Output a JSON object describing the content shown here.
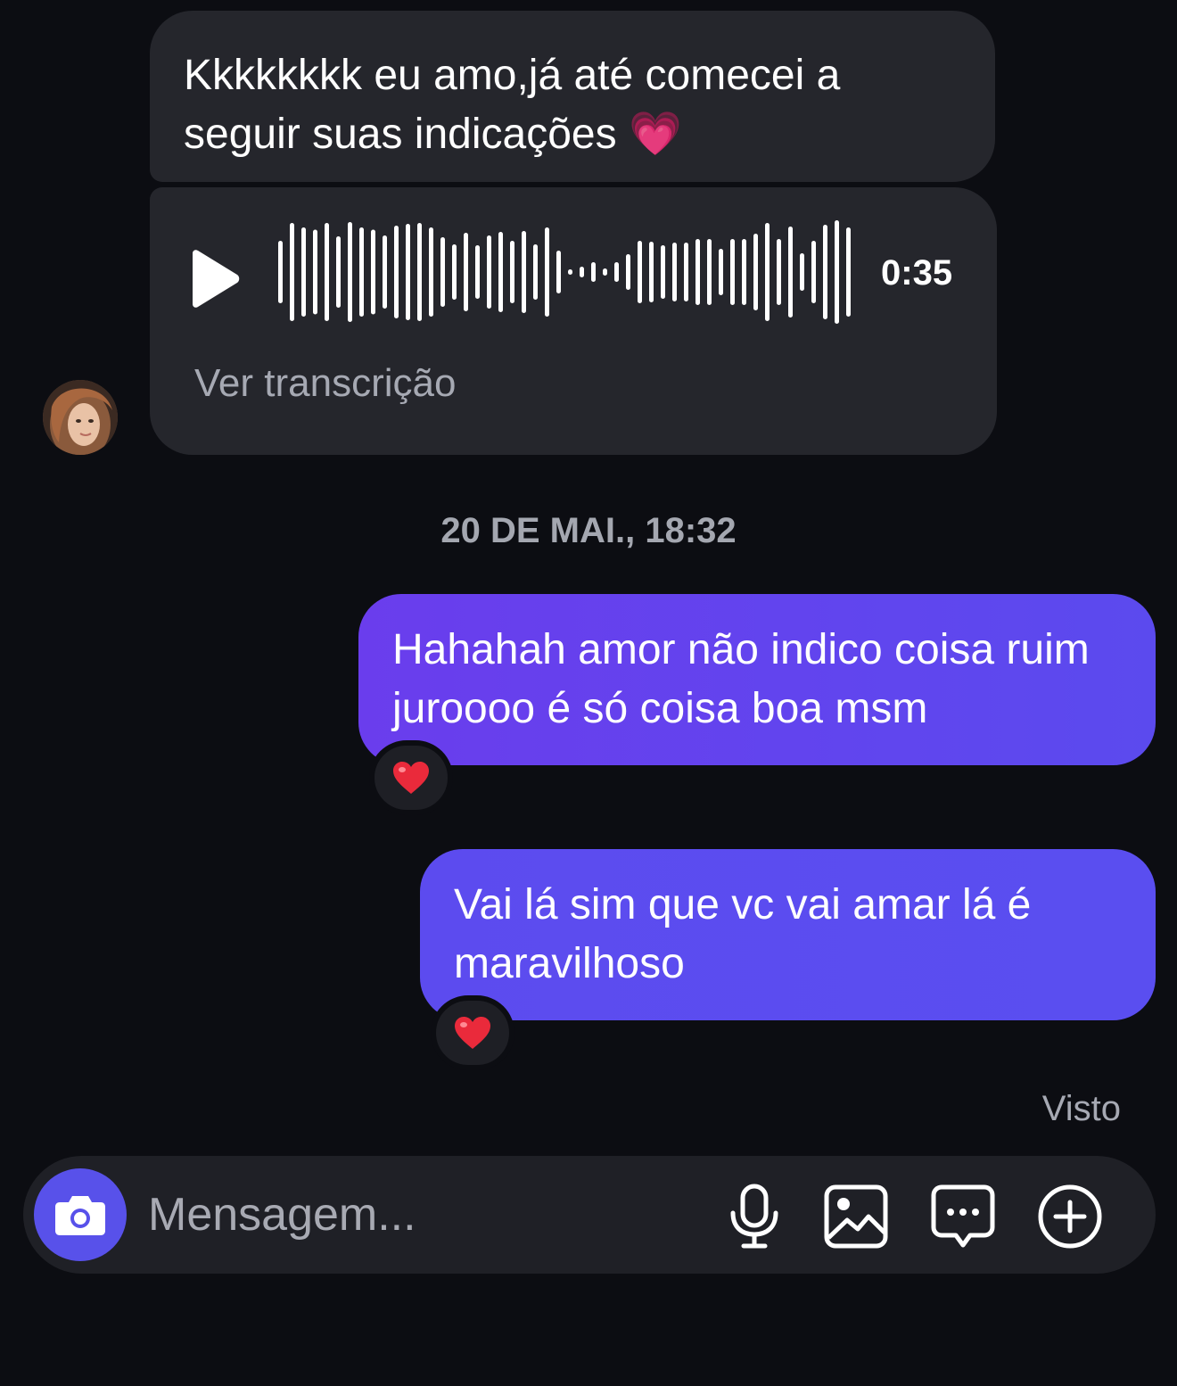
{
  "messages": {
    "incoming_text": "Kkkkkkkk eu amo,já até comecei a seguir suas indicações 💗",
    "audio": {
      "duration": "0:35",
      "transcript_label": "Ver transcrição"
    },
    "timestamp": "20 DE MAI., 18:32",
    "outgoing_1": "Hahahah amor não indico coisa ruim juroooo é só coisa boa msm",
    "outgoing_2": "Vai lá sim que vc vai amar lá é maravilhoso",
    "reaction_1": "❤️",
    "reaction_2": "❤️",
    "seen_label": "Visto"
  },
  "composer": {
    "placeholder": "Mensagem..."
  },
  "icons": {
    "play": "play-icon",
    "camera": "camera-icon",
    "mic": "microphone-icon",
    "gallery": "image-icon",
    "sticker": "chat-bubble-dots-icon",
    "plus": "plus-circle-icon"
  },
  "colors": {
    "background": "#0c0d12",
    "incoming_bubble": "#25262c",
    "outgoing_bubble": "#5b4aee",
    "accent": "#5851ea",
    "muted_text": "#a6a9b3"
  }
}
